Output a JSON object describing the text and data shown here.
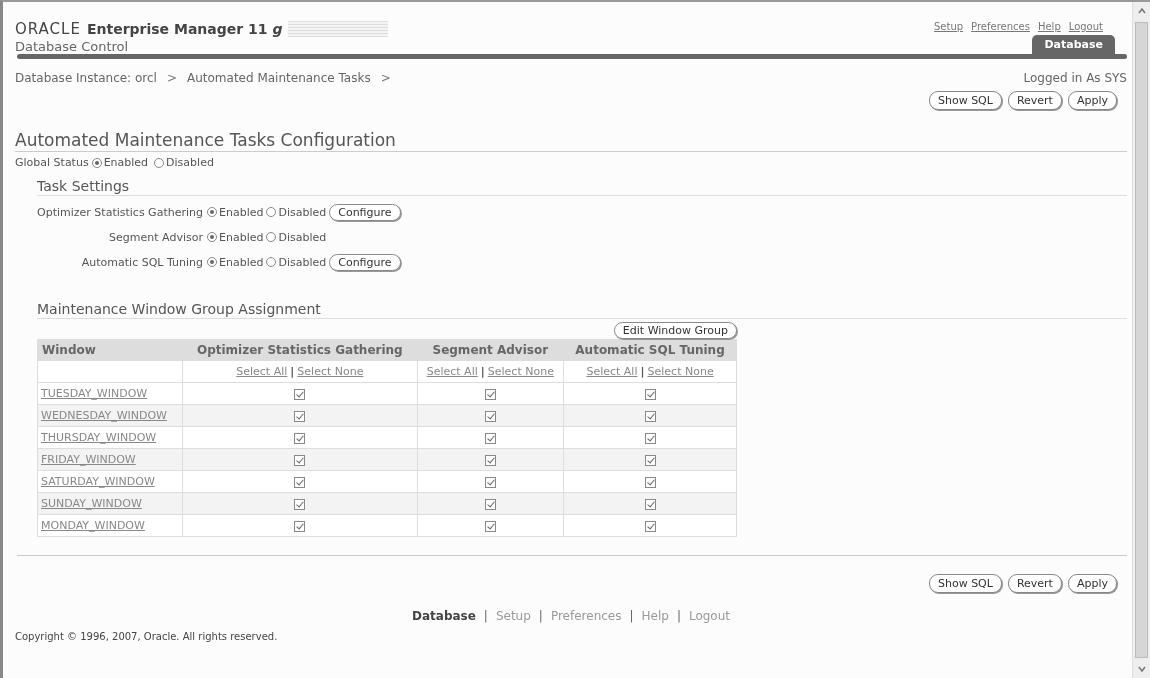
{
  "header": {
    "brand": "ORACLE",
    "product": "Enterprise Manager 11 *g*",
    "subtitle": "Database Control",
    "global_links": [
      "Setup",
      "Preferences",
      "Help",
      "Logout"
    ],
    "tabs": [
      {
        "label": "Database",
        "selected": true
      }
    ]
  },
  "breadcrumb": {
    "items": [
      "Database Instance: orcl",
      "Automated Maintenance Tasks"
    ],
    "separator": ">"
  },
  "logged_in": "Logged in As SYS",
  "top_buttons": [
    "Show SQL",
    "Revert",
    "Apply"
  ],
  "title": "Automated Maintenance Tasks Configuration",
  "global_status": {
    "label": "Global Status",
    "options": [
      {
        "label": "Enabled",
        "selected": true
      },
      {
        "label": "Disabled",
        "selected": false
      }
    ]
  },
  "task_settings": {
    "heading": "Task Settings",
    "tasks": [
      {
        "name": "Optimizer Statistics Gathering",
        "options": [
          {
            "label": "Enabled",
            "selected": true
          },
          {
            "label": "Disabled",
            "selected": false
          }
        ],
        "configure": "Configure"
      },
      {
        "name": "Segment Advisor",
        "options": [
          {
            "label": "Enabled",
            "selected": true
          },
          {
            "label": "Disabled",
            "selected": false
          }
        ]
      },
      {
        "name": "Automatic SQL Tuning",
        "options": [
          {
            "label": "Enabled",
            "selected": true
          },
          {
            "label": "Disabled",
            "selected": false
          }
        ],
        "configure": "Configure"
      }
    ]
  },
  "window_group": {
    "heading": "Maintenance Window Group Assignment",
    "edit_button": "Edit Window Group",
    "columns": [
      "Window",
      "Optimizer Statistics Gathering",
      "Segment Advisor",
      "Automatic SQL Tuning"
    ],
    "select_links": [
      {
        "all": "Select All",
        "separator": "|",
        "none": "Select None"
      },
      {
        "all": "Select All",
        "separator": "|",
        "none": "Select None"
      },
      {
        "all": "Select All",
        "separator": "|",
        "none": "Select None"
      }
    ],
    "rows": [
      {
        "window": "TUESDAY_WINDOW",
        "checked": [
          true,
          true,
          true
        ]
      },
      {
        "window": "WEDNESDAY_WINDOW",
        "checked": [
          true,
          true,
          true
        ]
      },
      {
        "window": "THURSDAY_WINDOW",
        "checked": [
          true,
          true,
          true
        ]
      },
      {
        "window": "FRIDAY_WINDOW",
        "checked": [
          true,
          true,
          true
        ]
      },
      {
        "window": "SATURDAY_WINDOW",
        "checked": [
          true,
          true,
          true
        ]
      },
      {
        "window": "SUNDAY_WINDOW",
        "checked": [
          true,
          true,
          true
        ]
      },
      {
        "window": "MONDAY_WINDOW",
        "checked": [
          true,
          true,
          true
        ]
      }
    ]
  },
  "bottom_buttons": [
    "Show SQL",
    "Revert",
    "Apply"
  ],
  "footer_links": [
    {
      "label": "Database",
      "selected": true
    },
    {
      "label": "Setup",
      "selected": false
    },
    {
      "label": "Preferences",
      "selected": false
    },
    {
      "label": "Help",
      "selected": false
    },
    {
      "label": "Logout",
      "selected": false
    }
  ],
  "footer_separator": "|",
  "copyright": "Copyright © 1996, 2007, Oracle. All rights reserved."
}
